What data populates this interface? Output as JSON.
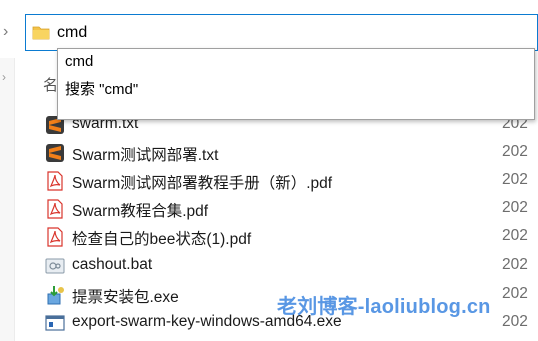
{
  "address_bar": {
    "value": "cmd"
  },
  "autocomplete": {
    "options": [
      "cmd",
      "搜索 \"cmd\""
    ]
  },
  "columns": {
    "name_header": "名",
    "date_header": ""
  },
  "files": [
    {
      "name": "swarm.txt",
      "icon": "sublime-text-icon",
      "date": "202"
    },
    {
      "name": "Swarm测试网部署.txt",
      "icon": "sublime-text-icon",
      "date": "202"
    },
    {
      "name": "Swarm测试网部署教程手册（新）.pdf",
      "icon": "pdf-icon",
      "date": "202"
    },
    {
      "name": "Swarm教程合集.pdf",
      "icon": "pdf-icon",
      "date": "202"
    },
    {
      "name": "检查自己的bee状态(1).pdf",
      "icon": "pdf-icon",
      "date": "202"
    },
    {
      "name": "cashout.bat",
      "icon": "batch-file-icon",
      "date": "202"
    },
    {
      "name": "提票安装包.exe",
      "icon": "installer-icon",
      "date": "202"
    },
    {
      "name": "export-swarm-key-windows-amd64.exe",
      "icon": "exe-window-icon",
      "date": "202"
    }
  ],
  "watermark": {
    "text": "老刘博客-laoliublog.cn"
  },
  "colors": {
    "accent": "#0b7bd1",
    "pdf": "#d9352c",
    "sublime": "#f17f19",
    "watermark": "#3d86e0"
  }
}
